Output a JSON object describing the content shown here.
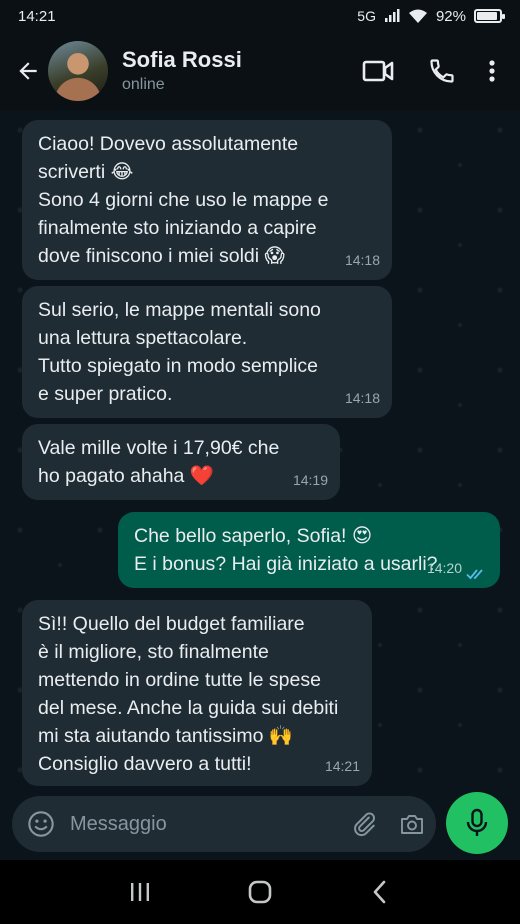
{
  "status_bar": {
    "time": "14:21",
    "network": "5G",
    "battery": "92%",
    "battery_level": 0.92
  },
  "header": {
    "contact_name": "Sofia Rossi",
    "contact_status": "online"
  },
  "messages": [
    {
      "direction": "in",
      "lines": [
        "Ciaoo! Dovevo assolutamente",
        "scriverti 😂",
        "Sono 4 giorni che uso le mappe e",
        "finalmente sto iniziando a capire",
        "dove finiscono i miei soldi 😱"
      ],
      "time": "14:18"
    },
    {
      "direction": "in",
      "lines": [
        "Sul serio, le mappe mentali sono",
        "una lettura spettacolare.",
        "Tutto spiegato in modo semplice",
        "e super pratico."
      ],
      "time": "14:18"
    },
    {
      "direction": "in",
      "lines": [
        "Vale mille volte i 17,90€ che",
        "ho pagato ahaha ❤️"
      ],
      "time": "14:19"
    },
    {
      "direction": "out",
      "lines": [
        "Che bello saperlo, Sofia! 😍",
        "E i bonus? Hai già iniziato a usarli?"
      ],
      "time": "14:20",
      "read": true
    },
    {
      "direction": "in",
      "lines": [
        "Sì!! Quello del budget familiare",
        "è il migliore, sto finalmente",
        "mettendo in ordine tutte le spese",
        "del mese. Anche la guida sui debiti",
        "mi sta aiutando tantissimo 🙌",
        "Consiglio davvero a tutti!"
      ],
      "time": "14:21"
    }
  ],
  "input": {
    "placeholder": "Messaggio"
  },
  "icons": {
    "back": "back-arrow-icon",
    "video": "video-call-icon",
    "call": "phone-icon",
    "menu": "more-vert-icon",
    "emoji": "emoji-icon",
    "attach": "paperclip-icon",
    "camera": "camera-icon",
    "mic": "microphone-icon",
    "nav_recent": "recent-apps-icon",
    "nav_home": "home-icon",
    "nav_back": "nav-back-icon"
  },
  "colors": {
    "incoming_bubble": "#1f2c34",
    "outgoing_bubble": "#005c4b",
    "accent": "#21c063",
    "read_ticks": "#53bdeb"
  }
}
